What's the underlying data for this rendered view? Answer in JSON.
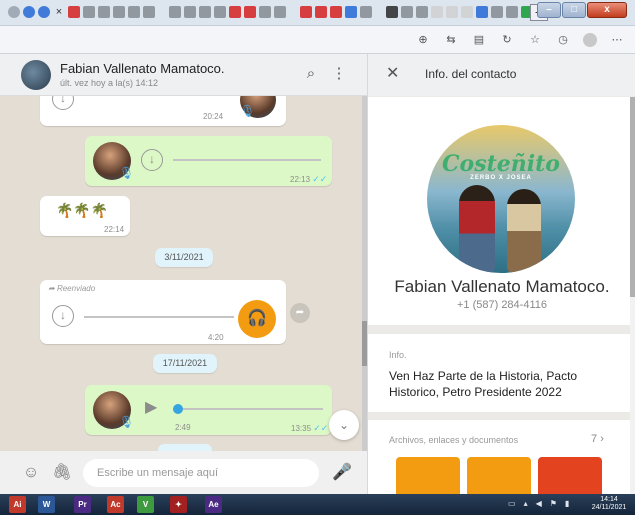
{
  "browser": {
    "tab_icons": [
      "#9aa4b1",
      "#2f6fd6",
      "#2f6fd6",
      "x",
      "#d62b2b",
      "#8a8f96",
      "#8a8f96",
      "#8a8f96",
      "#8a8f96",
      "#8a8f96",
      "|",
      "#8a8f96",
      "#8a8f96",
      "#8a8f96",
      "#8a8f96",
      "#d62b2b",
      "#d62b2b",
      "#8a8f96",
      "#8a8f96",
      "|",
      "#d62b2b",
      "#d62b2b",
      "#d62b2b",
      "#2f6fd6",
      "#8a8f96",
      "|",
      "#333333",
      "#8a8f96",
      "#8a8f96",
      "#d0d0d0",
      "#d0d0d0",
      "#d0d0d0",
      "#2f6fd6",
      "#8a8f96",
      "#8a8f96",
      "#1e9e3e",
      "#2f6fd6"
    ],
    "new_tab_label": "+",
    "window_buttons": [
      "–",
      "□",
      "x"
    ]
  },
  "chat": {
    "name": "Fabian Vallenato Mamatoco.",
    "last_seen": "últ. vez hoy a la(s) 14:12",
    "messages": {
      "m1_time": "20:24",
      "m2_time": "22:13",
      "m3_emoji": "🌴🌴🌴",
      "m3_time": "22:14",
      "date1": "3/11/2021",
      "m4_forwarded": "Reenviado",
      "m4_time": "4:20",
      "date2": "17/11/2021",
      "m5_duration": "2:49",
      "m5_time": "13:35"
    },
    "composer_placeholder": "Escribe un mensaje aquí"
  },
  "contact": {
    "panel_title": "Info. del contacto",
    "profile_art_title": "Costeñito",
    "profile_art_sub": "ZERBO X JOSEA",
    "name": "Fabian Vallenato Mamatoco.",
    "phone": "+1 (587) 284-4116",
    "info_label": "Info.",
    "info_text": "Ven Haz Parte de la Historia, Pacto Historico, Petro Presidente 2022",
    "files_label": "Archivos, enlaces y documentos",
    "files_count": "7",
    "media_colors": [
      "#f39c12",
      "#f39c12",
      "#e3431f"
    ]
  },
  "taskbar": {
    "apps": [
      {
        "label": "Ai",
        "color": "#c0392b"
      },
      {
        "label": "W",
        "color": "#2b5797"
      },
      {
        "label": "Pr",
        "color": "#4b2a84"
      },
      {
        "label": "Ac",
        "color": "#c0392b"
      },
      {
        "label": "V",
        "color": "#3e9a3e"
      },
      {
        "label": "✦",
        "color": "#a32020"
      },
      {
        "label": "Ae",
        "color": "#4b2a84"
      }
    ],
    "time": "14:14",
    "date": "24/11/2021"
  }
}
